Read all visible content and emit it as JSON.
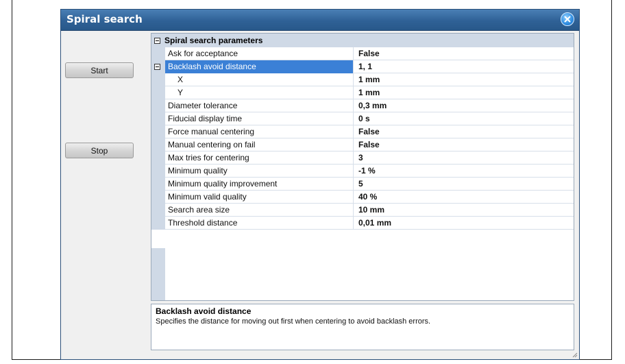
{
  "window": {
    "title": "Spiral search"
  },
  "buttons": {
    "start": "Start",
    "stop": "Stop"
  },
  "grid": {
    "category": "Spiral search parameters",
    "rows": [
      {
        "name": "Ask for acceptance",
        "value": "False"
      },
      {
        "name": "Backlash avoid distance",
        "value": "1, 1",
        "selected": true,
        "expanded": true
      },
      {
        "name": "X",
        "value": "1 mm",
        "child": true
      },
      {
        "name": "Y",
        "value": "1 mm",
        "child": true
      },
      {
        "name": "Diameter tolerance",
        "value": "0,3 mm"
      },
      {
        "name": "Fiducial display time",
        "value": "0 s"
      },
      {
        "name": "Force manual centering",
        "value": "False"
      },
      {
        "name": "Manual centering on fail",
        "value": "False"
      },
      {
        "name": "Max tries for centering",
        "value": "3"
      },
      {
        "name": "Minimum quality",
        "value": "-1 %"
      },
      {
        "name": "Minimum quality improvement",
        "value": "5"
      },
      {
        "name": "Minimum valid quality",
        "value": "40 %"
      },
      {
        "name": "Search area size",
        "value": "10 mm"
      },
      {
        "name": "Threshold distance",
        "value": "0,01 mm"
      }
    ]
  },
  "description": {
    "title": "Backlash avoid distance",
    "text": "Specifies the distance for moving out first when centering to avoid backlash errors."
  }
}
